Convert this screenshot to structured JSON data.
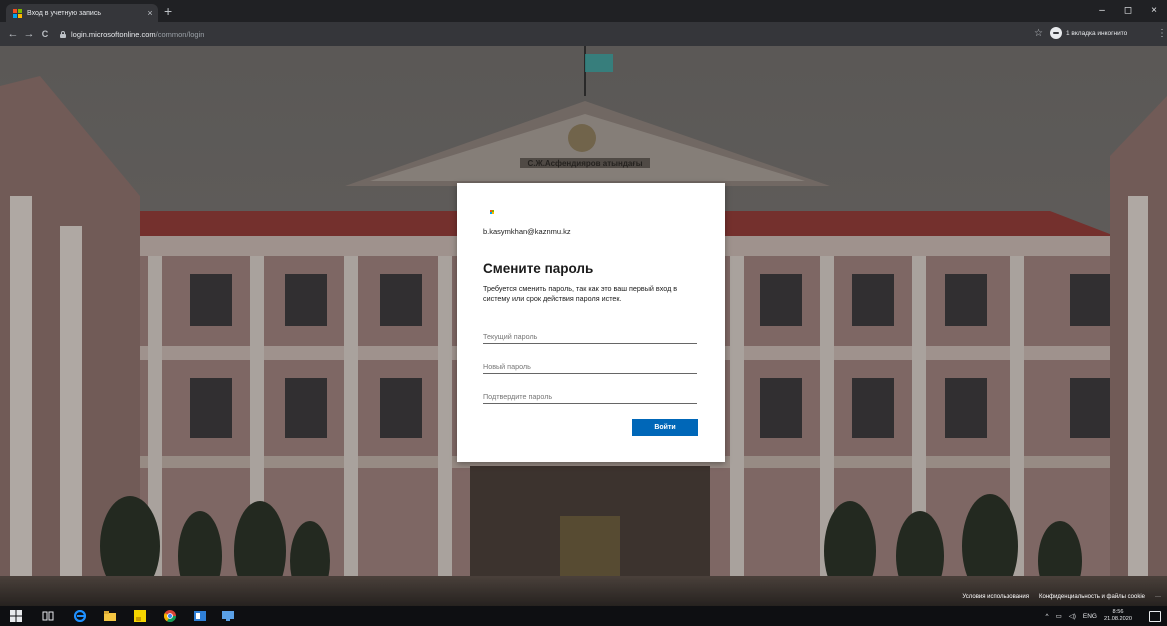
{
  "browser": {
    "tab_title": "Вход в учетную запись",
    "tab_close": "×",
    "new_tab": "+",
    "window_controls": {
      "minimize": "–",
      "maximize": "◻",
      "close": "×"
    },
    "url_host": "login.microsoftonline.com",
    "url_path": "/common/login",
    "back": "←",
    "forward": "→",
    "reload": "C",
    "bookmark_star": "☆",
    "incognito_label": "1 вкладка инкогнито",
    "menu": "⋮"
  },
  "background": {
    "building_sign": "С.Ж.Асфендияров атындағы"
  },
  "dialog": {
    "account_email": "b.kasymkhan@kaznmu.kz",
    "title": "Смените пароль",
    "description": "Требуется сменить пароль, так как это ваш первый вход в систему или срок действия пароля истек.",
    "current_password_placeholder": "Текущий пароль",
    "new_password_placeholder": "Новый пароль",
    "confirm_password_placeholder": "Подтвердите пароль",
    "sign_in_button": "Войти"
  },
  "footer": {
    "terms": "Условия использования",
    "privacy": "Конфиденциальность и файлы cookie",
    "more": "···"
  },
  "taskbar": {
    "language": "ENG",
    "time": "8:56",
    "date": "21.08.2020",
    "tray_chevron": "^"
  },
  "colors": {
    "ms_red": "#f25022",
    "ms_green": "#7fba00",
    "ms_blue": "#00a4ef",
    "ms_yellow": "#ffb900",
    "primary_button": "#0067b8"
  }
}
